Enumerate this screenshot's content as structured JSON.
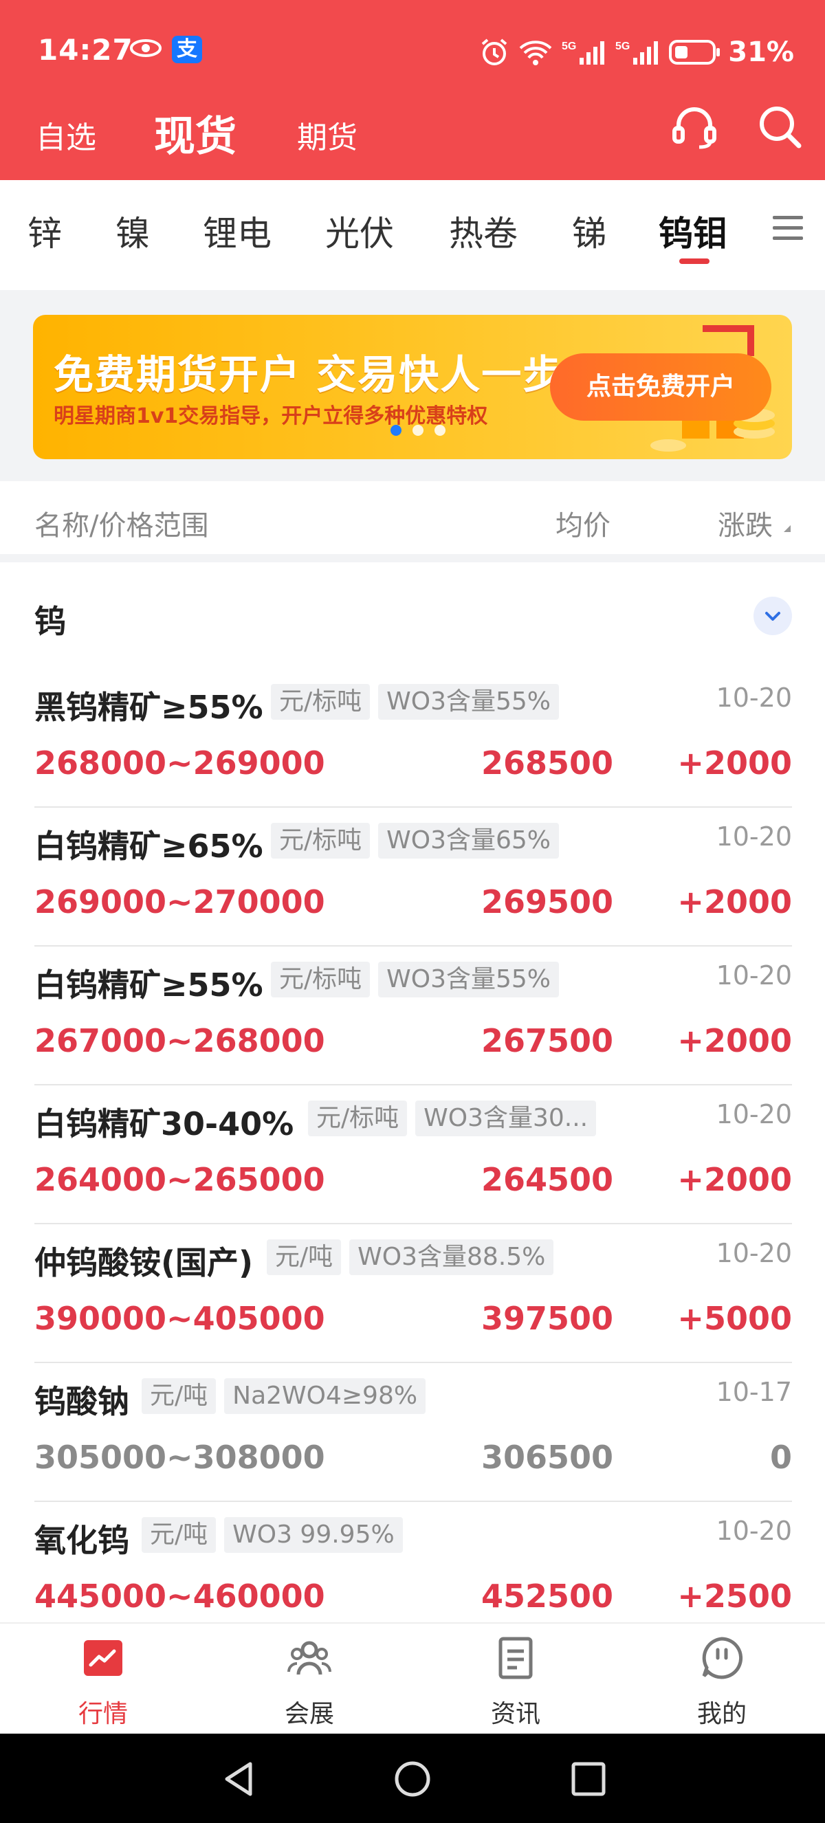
{
  "status_bar": {
    "time": "14:27",
    "battery": "31%"
  },
  "top_nav": {
    "tabs": [
      "自选",
      "现货",
      "期货"
    ],
    "active": "现货"
  },
  "categories": {
    "items": [
      "锌",
      "镍",
      "锂电",
      "光伏",
      "热卷",
      "锑",
      "钨钼"
    ],
    "active": "钨钼"
  },
  "banner": {
    "title": "免费期货开户  交易快人一步",
    "subtitle": "明星期商1v1交易指导，开户立得多种优惠特权",
    "button": "点击免费开户"
  },
  "columns": {
    "name": "名称/价格范围",
    "avg": "均价",
    "change": "涨跌"
  },
  "group": {
    "title": "钨"
  },
  "rows": [
    {
      "name": "黑钨精矿≥55%",
      "unit": "元/标吨",
      "spec": "WO3含量55%",
      "date": "10-20",
      "range": "268000~269000",
      "avg": "268500",
      "change": "+2000",
      "trend": "up"
    },
    {
      "name": "白钨精矿≥65%",
      "unit": "元/标吨",
      "spec": "WO3含量65%",
      "date": "10-20",
      "range": "269000~270000",
      "avg": "269500",
      "change": "+2000",
      "trend": "up"
    },
    {
      "name": "白钨精矿≥55%",
      "unit": "元/标吨",
      "spec": "WO3含量55%",
      "date": "10-20",
      "range": "267000~268000",
      "avg": "267500",
      "change": "+2000",
      "trend": "up"
    },
    {
      "name": "白钨精矿30-40%",
      "unit": "元/标吨",
      "spec": "WO3含量30...",
      "date": "10-20",
      "range": "264000~265000",
      "avg": "264500",
      "change": "+2000",
      "trend": "up"
    },
    {
      "name": "仲钨酸铵(国产)",
      "unit": "元/吨",
      "spec": "WO3含量88.5%",
      "date": "10-20",
      "range": "390000~405000",
      "avg": "397500",
      "change": "+5000",
      "trend": "up"
    },
    {
      "name": "钨酸钠",
      "unit": "元/吨",
      "spec": "Na2WO4≥98%",
      "date": "10-17",
      "range": "305000~308000",
      "avg": "306500",
      "change": "0",
      "trend": "flat"
    },
    {
      "name": "氧化钨",
      "unit": "元/吨",
      "spec": "WO3 99.95%",
      "date": "10-20",
      "range": "445000~460000",
      "avg": "452500",
      "change": "+2500",
      "trend": "up"
    }
  ],
  "tabbar": {
    "items": [
      "行情",
      "会展",
      "资讯",
      "我的"
    ],
    "active": "行情"
  },
  "colors": {
    "header_red": "#f24a4d",
    "price_red": "#e0394a",
    "flat_gray": "#8a8a8a"
  }
}
